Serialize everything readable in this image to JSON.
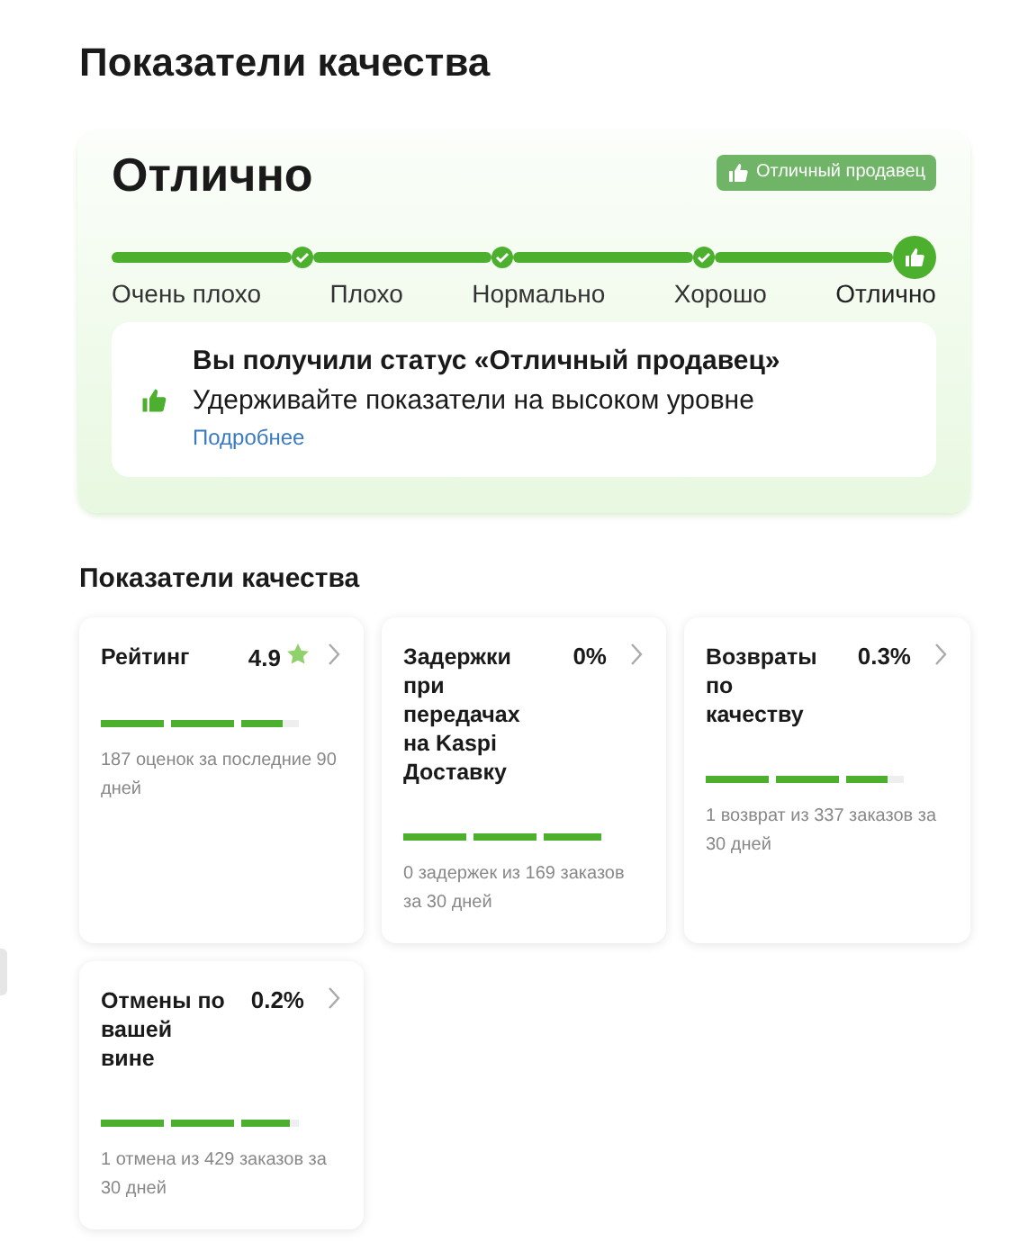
{
  "title": "Показатели качества",
  "status": {
    "grade": "Отлично",
    "badge": "Отличный продавец",
    "steps": [
      {
        "label": "Очень плохо",
        "selected": false
      },
      {
        "label": "Плохо",
        "selected": false
      },
      {
        "label": "Нормально",
        "selected": false
      },
      {
        "label": "Хорошо",
        "selected": false
      },
      {
        "label": "Отлично",
        "selected": true
      }
    ],
    "notice": {
      "title": "Вы получили статус «Отличный продавец»",
      "text": "Удерживайте показатели на высоком уровне",
      "link": "Подробнее"
    }
  },
  "metrics_title": "Показатели качества",
  "metrics": [
    {
      "name": "Рейтинг",
      "value": "4.9",
      "kind": "rating",
      "level": 0.92,
      "note": "187 оценок за последние 90 дней"
    },
    {
      "name": "Задержки при передачах на Kaspi Доставку",
      "value": "0%",
      "kind": "percent",
      "level": 1,
      "note": "0 задержек из 169 заказов за 30 дней"
    },
    {
      "name": "Возвраты по качеству",
      "value": "0.3%",
      "kind": "percent",
      "level": 0.92,
      "note": "1 возврат из 337 заказов за 30 дней"
    },
    {
      "name": "Отмены по вашей вине",
      "value": "0.2%",
      "kind": "percent",
      "level": 0.95,
      "note": "1 отмена из 429 заказов за 30 дней"
    }
  ]
}
